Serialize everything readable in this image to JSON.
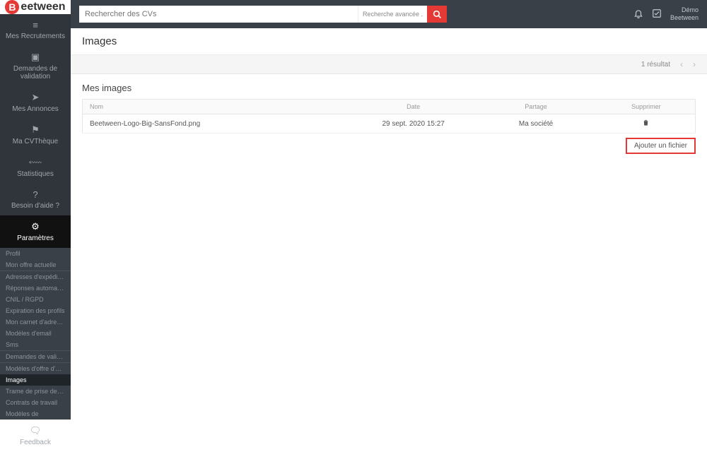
{
  "brand": "eetween",
  "search": {
    "placeholder": "Rechercher des CVs",
    "advanced": "Recherche avancée ."
  },
  "user": {
    "line1": "Démo",
    "line2": "Beetween"
  },
  "sidebar": {
    "items": [
      {
        "label": "Mes Recrutements",
        "icon": "≡"
      },
      {
        "label": "Demandes de validation",
        "icon": "▣"
      },
      {
        "label": "Mes Annonces",
        "icon": "➤"
      },
      {
        "label": "Ma CVThèque",
        "icon": "⚑"
      },
      {
        "label": "Statistiques",
        "icon": "⬳"
      },
      {
        "label": "Besoin d'aide ?",
        "icon": "?"
      },
      {
        "label": "Paramètres",
        "icon": "⚙"
      }
    ],
    "sub_groups": [
      [
        "Profil",
        "Mon offre actuelle"
      ],
      [
        "Adresses d'expédition",
        "Réponses automatiques",
        "CNIL / RGPD",
        "Expiration des profils",
        "Mon carnet d'adresses",
        "Modèles d'email",
        "Sms"
      ],
      [
        "Demandes de validation"
      ],
      [
        "Modèles d'offre d'emploi",
        "Images",
        "Trame de prise de note",
        "Contrats de travail",
        "Modèles de"
      ]
    ],
    "feedback": {
      "label": "Feedback",
      "icon": "🗨"
    }
  },
  "page": {
    "title": "Images"
  },
  "toolbar": {
    "result_count": "1 résultat"
  },
  "section": {
    "title": "Mes images"
  },
  "table": {
    "headers": [
      "Nom",
      "Date",
      "Partage",
      "Supprimer"
    ],
    "rows": [
      {
        "name": "Beetween-Logo-Big-SansFond.png",
        "date": "29 sept. 2020 15:27",
        "partage": "Ma société"
      }
    ]
  },
  "add_button": "Ajouter un fichier"
}
